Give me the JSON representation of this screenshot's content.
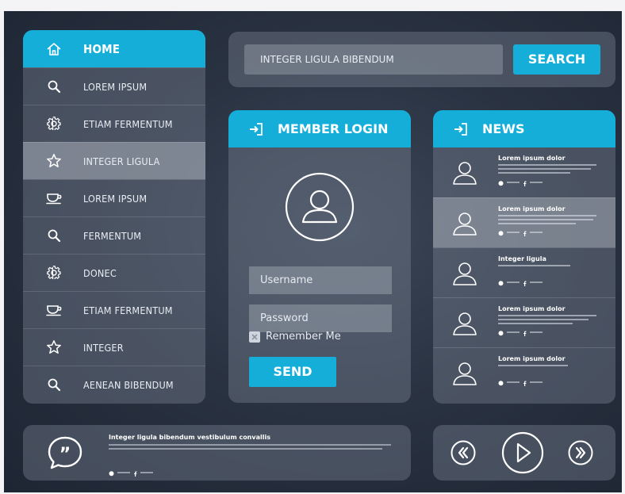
{
  "colors": {
    "accent": "#14aed8",
    "background": "#262e3c"
  },
  "sidebar": {
    "items": [
      {
        "label": "HOME",
        "icon": "home-icon"
      },
      {
        "label": "LOREM IPSUM",
        "icon": "search-icon"
      },
      {
        "label": "ETIAM FERMENTUM",
        "icon": "gear-icon"
      },
      {
        "label": "INTEGER LIGULA",
        "icon": "star-icon"
      },
      {
        "label": "LOREM IPSUM",
        "icon": "cup-icon"
      },
      {
        "label": "FERMENTUM",
        "icon": "search-icon"
      },
      {
        "label": "DONEC",
        "icon": "gear-icon"
      },
      {
        "label": "ETIAM FERMENTUM",
        "icon": "cup-icon"
      },
      {
        "label": "INTEGER",
        "icon": "star-icon"
      },
      {
        "label": "AENEAN BIBENDUM",
        "icon": "search-icon"
      }
    ]
  },
  "search": {
    "value": "INTEGER LIGULA BIBENDUM",
    "button_label": "SEARCH"
  },
  "login": {
    "title": "MEMBER LOGIN",
    "username_placeholder": "Username",
    "password_placeholder": "Password",
    "remember_label": "Remember Me",
    "send_label": "SEND"
  },
  "news": {
    "title": "NEWS",
    "items": [
      {
        "title": "Lorem ipsum dolor"
      },
      {
        "title": "Lorem ipsum dolor"
      },
      {
        "title": "Integer ligula"
      },
      {
        "title": "Lorem ipsum dolor"
      },
      {
        "title": "Lorem ipsum dolor"
      }
    ]
  },
  "quote": {
    "title": "Integer ligula bibendum vestibulum convallis"
  }
}
